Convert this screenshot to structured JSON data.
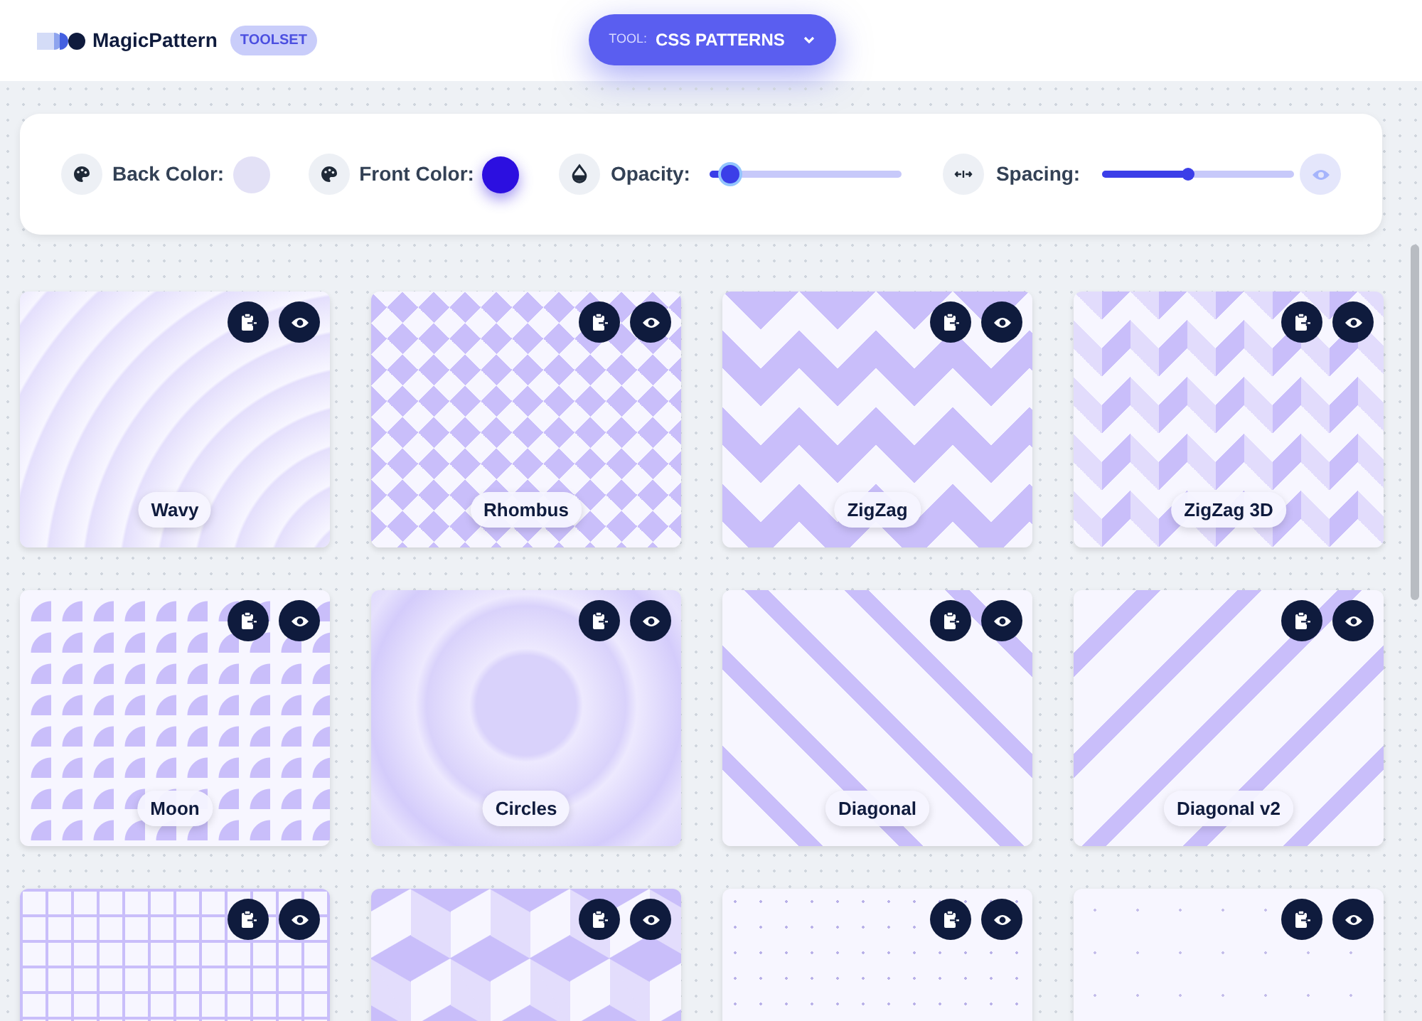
{
  "header": {
    "brand": "MagicPattern",
    "badge": "TOOLSET",
    "tool_button": {
      "label": "TOOL:",
      "value": "CSS PATTERNS"
    }
  },
  "controls": {
    "back_color": {
      "label": "Back Color:",
      "color": "#e3e1f6"
    },
    "front_color": {
      "label": "Front Color:",
      "color": "#2c0fe0"
    },
    "opacity": {
      "label": "Opacity:",
      "level": 0.1
    },
    "spacing": {
      "label": "Spacing:",
      "level": 0.45
    }
  },
  "patterns": [
    {
      "name": "Wavy",
      "kind": "wavy"
    },
    {
      "name": "Rhombus",
      "kind": "rhombus"
    },
    {
      "name": "ZigZag",
      "kind": "zigzag"
    },
    {
      "name": "ZigZag 3D",
      "kind": "zigzag3d"
    },
    {
      "name": "Moon",
      "kind": "moon"
    },
    {
      "name": "Circles",
      "kind": "circles"
    },
    {
      "name": "Diagonal",
      "kind": "diagonal"
    },
    {
      "name": "Diagonal v2",
      "kind": "diagonal2"
    },
    {
      "kind": "grid"
    },
    {
      "kind": "isometric"
    },
    {
      "kind": "dots"
    },
    {
      "kind": "sparse_dots"
    }
  ]
}
